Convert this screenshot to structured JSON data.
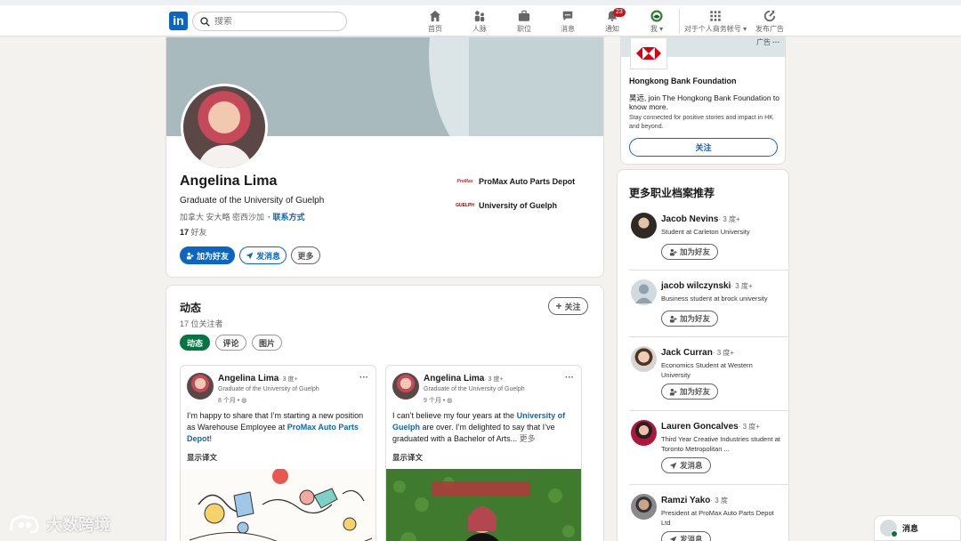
{
  "nav": {
    "logo_text": "in",
    "search_placeholder": "搜索",
    "items": [
      {
        "icon": "home-icon",
        "label": "首页"
      },
      {
        "icon": "network-icon",
        "label": "人脉"
      },
      {
        "icon": "briefcase-icon",
        "label": "职位"
      },
      {
        "icon": "chat-icon",
        "label": "消息"
      },
      {
        "icon": "bell-icon",
        "label": "通知",
        "badge": "23"
      },
      {
        "icon": "avatar-icon",
        "label": "我"
      },
      {
        "icon": "grid-icon",
        "label": "对于个人商务帐号"
      },
      {
        "icon": "ads-icon",
        "label": "发布广告"
      }
    ]
  },
  "profile": {
    "name": "Angelina Lima",
    "headline": "Graduate of the University of Guelph",
    "location": "加拿大 安大略 密西沙加",
    "contact_link": "· 联系方式",
    "friends_count": "17",
    "friends_label": " 好友",
    "buttons": {
      "connect": "加为好友",
      "message": "发消息",
      "more": "更多"
    },
    "orgs": [
      {
        "logo_text": "ProMax",
        "name": "ProMax Auto Parts Depot"
      },
      {
        "logo_text": "GUELPH",
        "name": "University of Guelph"
      }
    ]
  },
  "activity": {
    "title": "动态",
    "followers": "17 位关注者",
    "follow_button": "关注",
    "tabs": [
      "动态",
      "评论",
      "图片"
    ],
    "posts": [
      {
        "author": "Angelina Lima",
        "degree": "· 3 度+",
        "headline": "Graduate of the University of Guelph",
        "time": "8 个月 •",
        "text_1": "I’m happy to share that I’m starting a new position as Warehouse Employee at ",
        "link_1": "ProMax Auto Parts Depot",
        "text_2": "!",
        "more": "",
        "translate": "显示译文"
      },
      {
        "author": "Angelina Lima",
        "degree": "· 3 度+",
        "headline": "Graduate of the University of Guelph",
        "time": "9 个月 •",
        "text_1": "I can’t believe my four years at the ",
        "link_1": "University of Guelph",
        "text_2": " are over. I’m delighted to say that I’ve graduated with a Bachelor of Arts...",
        "more": " 更多",
        "translate": "显示译文"
      }
    ]
  },
  "ad": {
    "tag": "广告",
    "org": "Hongkong Bank Foundation",
    "message": "昊远, join The Hongkong Bank Foundation to know more.",
    "sub": "Stay connected for positive stories and impact in HK and beyond.",
    "follow": "关注"
  },
  "recommendations": {
    "title": "更多职业档案推荐",
    "people": [
      {
        "name": "Jacob Nevins",
        "degree": "· 3 度+",
        "headline": "Student at Carleton University",
        "action": "加为好友",
        "action_icon": "add-person-icon"
      },
      {
        "name": "jacob wilczynski",
        "degree": "· 3 度+",
        "headline": "Business student at brock university",
        "action": "加为好友",
        "action_icon": "add-person-icon"
      },
      {
        "name": "Jack Curran",
        "degree": "· 3 度+",
        "headline": "Economics Student at Western University",
        "action": "加为好友",
        "action_icon": "add-person-icon"
      },
      {
        "name": "Lauren Goncalves",
        "degree": "· 3 度+",
        "headline": "Third Year Creative Industries student at Toronto Metropolitan ...",
        "action": "发消息",
        "action_icon": "send-icon"
      },
      {
        "name": "Ramzi Yako",
        "degree": "· 3 度",
        "headline": "President at ProMax Auto Parts Depot Ltd",
        "action": "发消息",
        "action_icon": "send-icon"
      }
    ]
  },
  "dock": {
    "label": "消息"
  },
  "watermark": {
    "text": "大数跨境"
  },
  "colors": {
    "brand": "#0a66c2",
    "green": "#057642",
    "badge": "#cc1016"
  }
}
